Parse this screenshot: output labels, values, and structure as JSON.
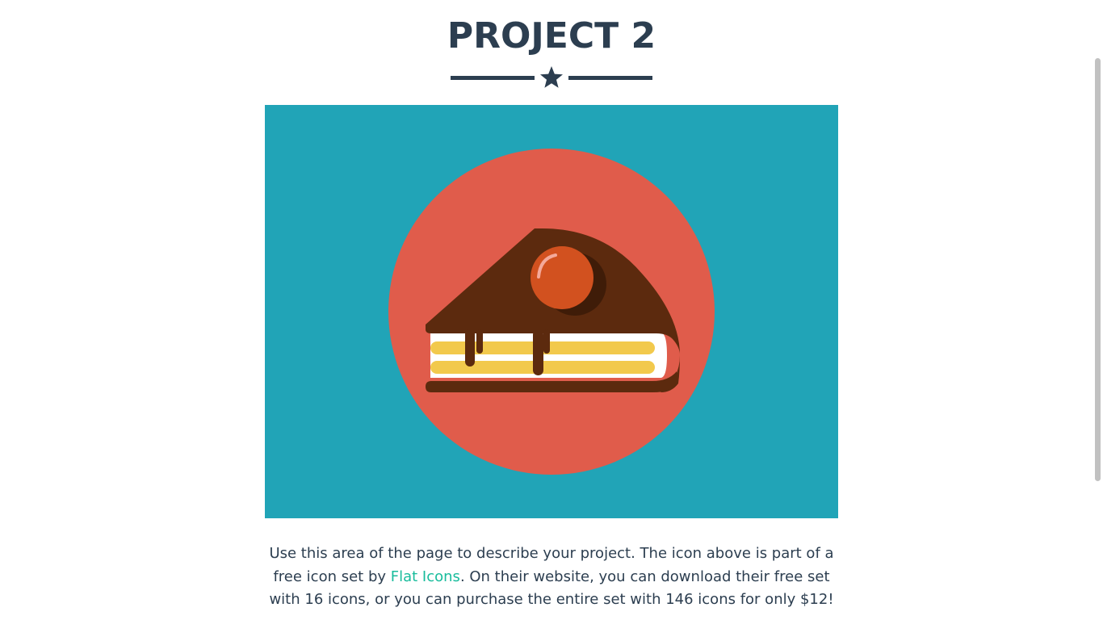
{
  "page": {
    "title": "PROJECT 2"
  },
  "image": {
    "icon": "cake-slice-icon",
    "colors": {
      "background": "#21a4b7",
      "circle": "#e05c4b",
      "chocolate": "#5c2a0e",
      "cherry": "#d2511f",
      "cream": "#ffffff",
      "sponge": "#f2c94c"
    }
  },
  "description": {
    "text_before": "Use this area of the page to describe your project. The icon above is part of a free icon set by ",
    "link_text": "Flat Icons",
    "text_after": ". On their website, you can download their free set with 16 icons, or you can purchase the entire set with 146 icons for only $12!"
  },
  "theme": {
    "primary": "#2c3e50",
    "link": "#18bc9c"
  }
}
